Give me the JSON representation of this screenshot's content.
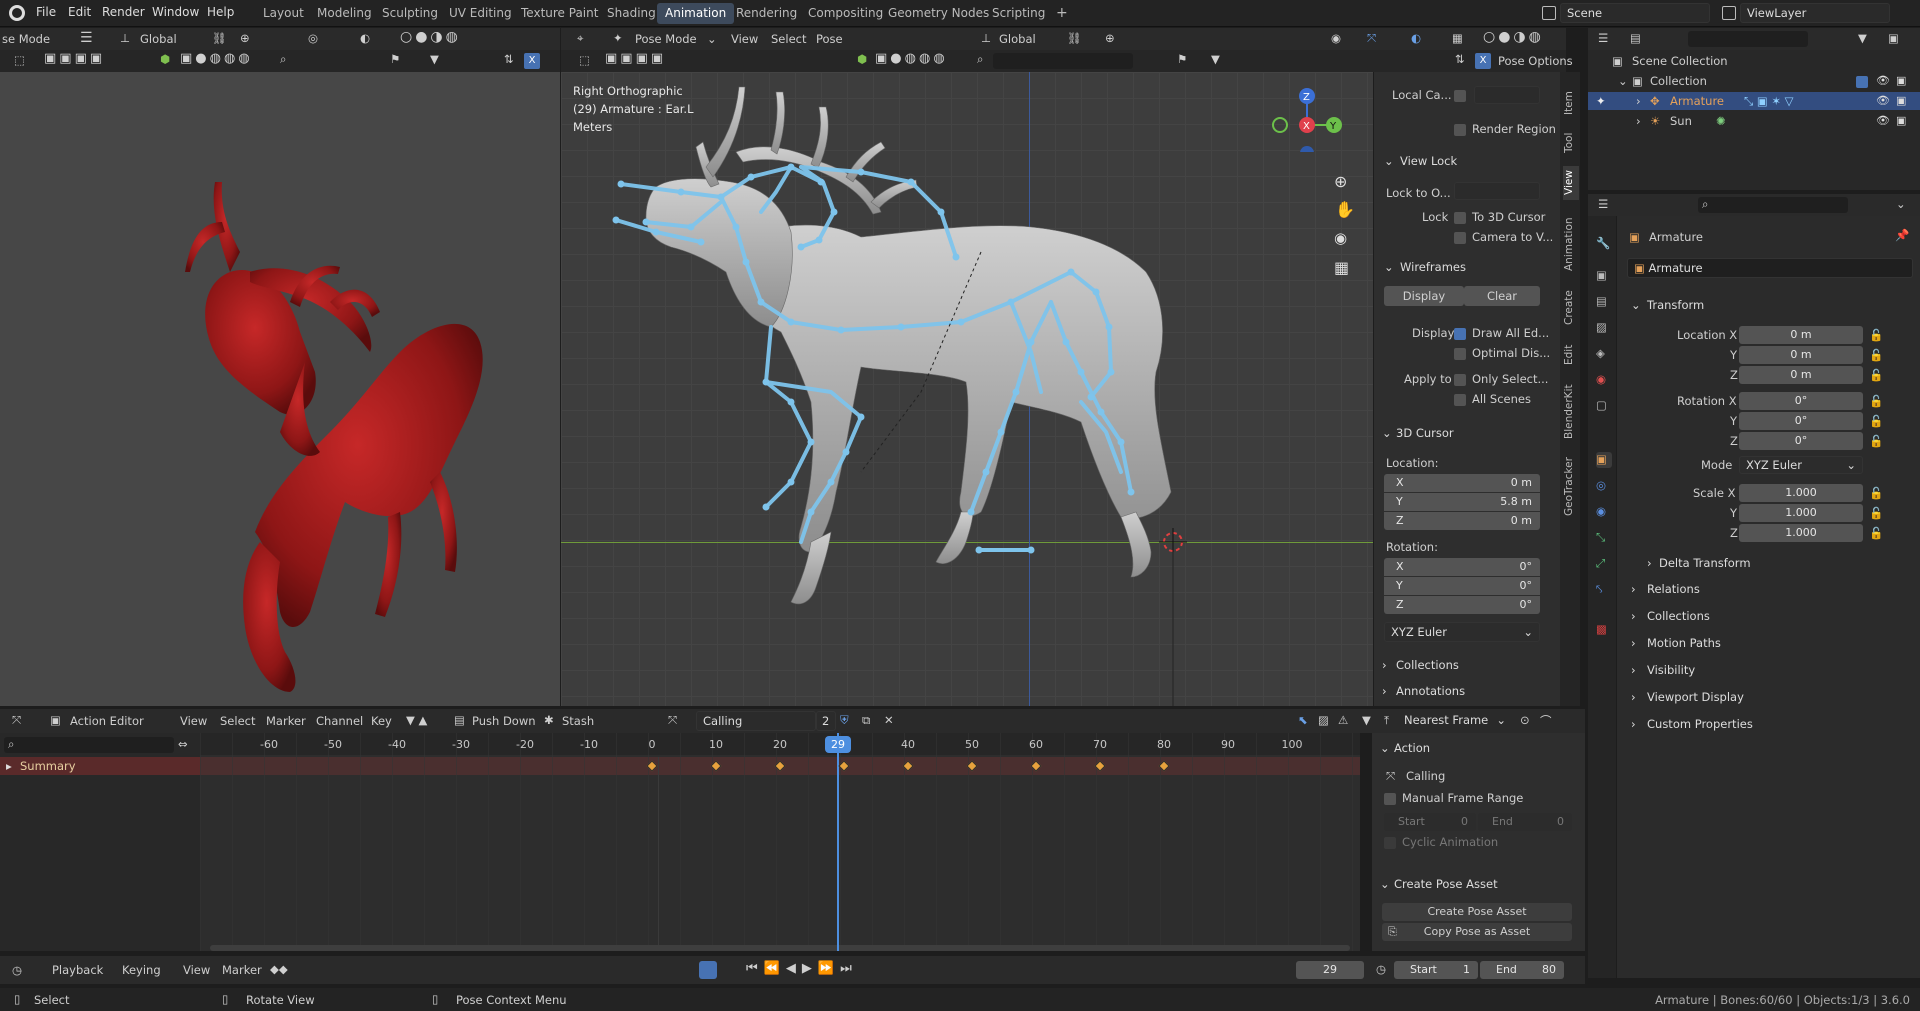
{
  "topbar": {
    "menus": [
      "File",
      "Edit",
      "Render",
      "Window",
      "Help"
    ],
    "workspaces": [
      "Layout",
      "Modeling",
      "Sculpting",
      "UV Editing",
      "Texture Paint",
      "Shading",
      "Animation",
      "Rendering",
      "Compositing",
      "Geometry Nodes",
      "Scripting"
    ],
    "active_workspace": "Animation",
    "add_tab": "+",
    "scene_name": "Scene",
    "view_layer": "ViewLayer"
  },
  "left_viewport": {
    "mode": "se Mode",
    "orientation": "Global",
    "object_color": "#b51f1f"
  },
  "main_viewport": {
    "mode": "Pose Mode",
    "menus": [
      "View",
      "Select",
      "Pose"
    ],
    "orientation": "Global",
    "pose_options": "Pose Options",
    "overlay_line1": "Right Orthographic",
    "overlay_line2": "(29) Armature : Ear.L",
    "overlay_line3": "Meters",
    "bone_color": "#7ec4ec"
  },
  "n_panel": {
    "tabs": [
      "Item",
      "Tool",
      "View",
      "Animation",
      "Create",
      "Edit",
      "BlenderKit",
      "GeoTracker"
    ],
    "local_camera": "Local Ca...",
    "render_region": "Render Region",
    "view_lock": "View Lock",
    "lock_to_object": "Lock to O...",
    "lock": "Lock",
    "to_3d_cursor": "To 3D Cursor",
    "camera_to_view": "Camera to V...",
    "wireframes": "Wireframes",
    "display_btn": "Display",
    "clear_btn": "Clear",
    "display_lbl": "Display",
    "draw_all_edges": "Draw All Ed...",
    "optimal_display": "Optimal Dis...",
    "apply_to": "Apply to",
    "only_selected": "Only Select...",
    "all_scenes": "All Scenes",
    "cursor_header": "3D Cursor",
    "location": "Location:",
    "loc_x": "0 m",
    "loc_y": "5.8 m",
    "loc_z": "0 m",
    "rotation": "Rotation:",
    "rot_x": "0°",
    "rot_y": "0°",
    "rot_z": "0°",
    "rot_mode": "XYZ Euler",
    "collections": "Collections",
    "annotations": "Annotations",
    "x": "X",
    "y": "Y",
    "z": "Z"
  },
  "outliner": {
    "scene_collection": "Scene Collection",
    "collection": "Collection",
    "armature": "Armature",
    "sun": "Sun"
  },
  "properties": {
    "object_name": "Armature",
    "data_name": "Armature",
    "transform": "Transform",
    "location_x_lbl": "Location X",
    "loc_x": "0 m",
    "loc_y": "0 m",
    "loc_z": "0 m",
    "rotation_x_lbl": "Rotation X",
    "rot_x": "0°",
    "rot_y": "0°",
    "rot_z": "0°",
    "mode_lbl": "Mode",
    "mode": "XYZ Euler",
    "scale_x_lbl": "Scale X",
    "scale_x": "1.000",
    "scale_y": "1.000",
    "scale_z": "1.000",
    "y": "Y",
    "z": "Z",
    "delta_transform": "Delta Transform",
    "sections": [
      "Relations",
      "Collections",
      "Motion Paths",
      "Visibility",
      "Viewport Display",
      "Custom Properties"
    ]
  },
  "action_editor": {
    "editor": "Action Editor",
    "menus": [
      "View",
      "Select",
      "Marker",
      "Channel",
      "Key"
    ],
    "push_down": "Push Down",
    "stash": "Stash",
    "action_name": "Calling",
    "users": "2",
    "snap": "Nearest Frame",
    "summary": "Summary",
    "ticks": [
      "-60",
      "-50",
      "-40",
      "-30",
      "-20",
      "-10",
      "0",
      "10",
      "20",
      "29",
      "40",
      "50",
      "60",
      "70",
      "80",
      "90",
      "100"
    ],
    "current_frame": "29",
    "keyframes": [
      0,
      10,
      20,
      30,
      40,
      50,
      60,
      70,
      80
    ]
  },
  "action_panel": {
    "action_header": "Action",
    "action_name": "Calling",
    "manual_range": "Manual Frame Range",
    "start_lbl": "Start",
    "start_val": "0",
    "end_lbl": "End",
    "end_val": "0",
    "cyclic": "Cyclic Animation",
    "create_pose_header": "Create Pose Asset",
    "create_pose_btn": "Create Pose Asset",
    "copy_pose_btn": "Copy Pose as Asset"
  },
  "timeline": {
    "menus": [
      "Playback",
      "Keying",
      "View",
      "Marker"
    ],
    "frame": "29",
    "start_lbl": "Start",
    "start": "1",
    "end_lbl": "End",
    "end": "80"
  },
  "statusbar": {
    "select": "Select",
    "rotate": "Rotate View",
    "context": "Pose Context Menu",
    "info": "Armature | Bones:60/60 | Objects:1/3 | 3.6.0"
  }
}
